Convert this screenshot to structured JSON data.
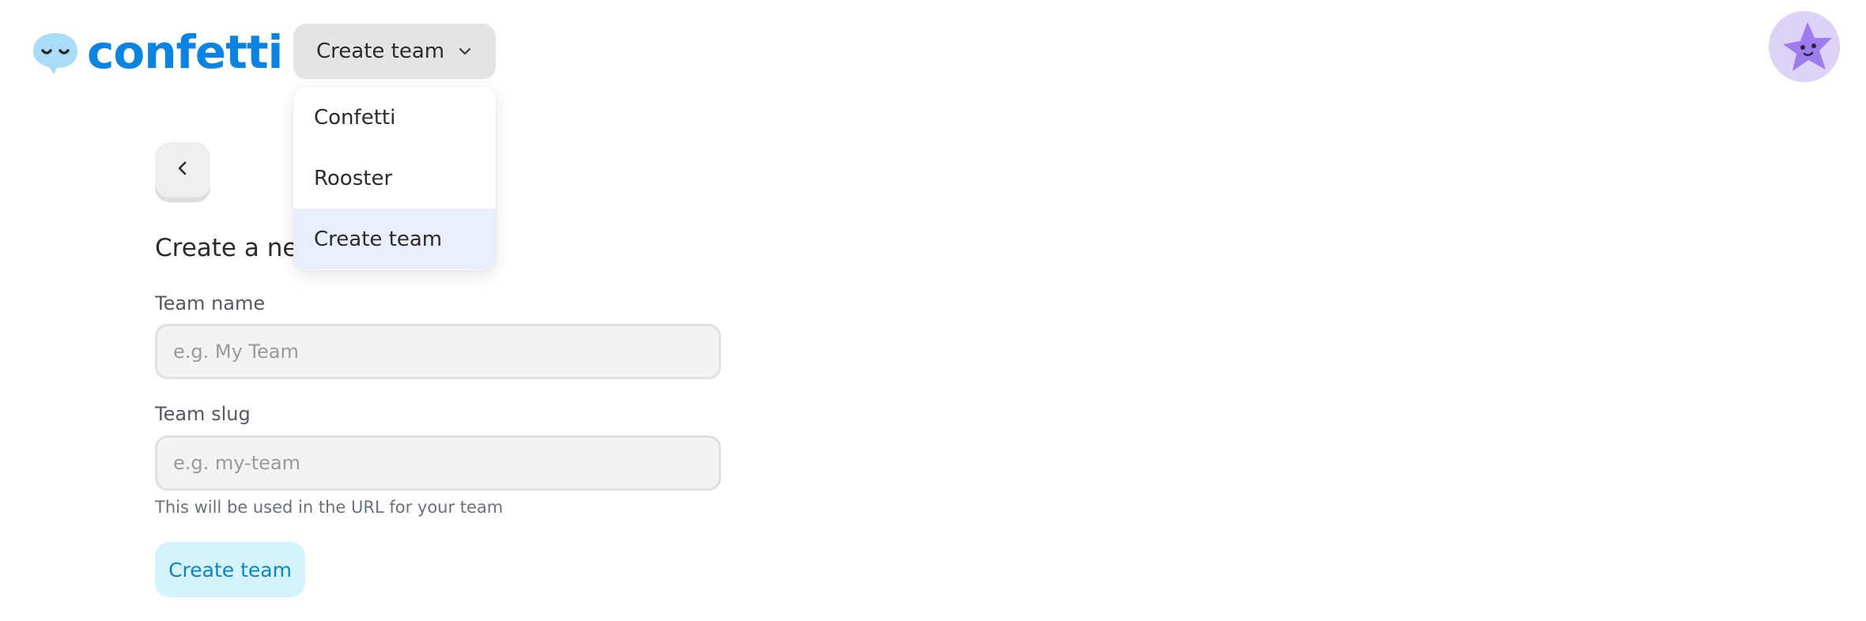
{
  "header": {
    "logo_text": "confetti",
    "team_select": {
      "selected": "Create team",
      "icon": "chevron-down-icon"
    },
    "avatar_icon": "star-avatar-icon"
  },
  "team_menu": {
    "items": [
      {
        "label": "Confetti"
      },
      {
        "label": "Rooster"
      },
      {
        "label": "Create team"
      }
    ],
    "active_index": 2
  },
  "main": {
    "back_icon": "chevron-left-icon",
    "heading": "Create a new team",
    "team_name": {
      "label": "Team name",
      "value": "",
      "placeholder": "e.g. My Team"
    },
    "team_slug": {
      "label": "Team slug",
      "value": "",
      "placeholder": "e.g. my-team",
      "hint": "This will be used in the URL for your team"
    },
    "submit_label": "Create team"
  },
  "colors": {
    "brand": "#0a84e0",
    "menu_active_bg": "#e8eefc",
    "button_bg": "#d4f3fc",
    "button_text": "#0b84c6",
    "avatar_bg": "#dcd3f6",
    "star": "#9d7cf0"
  }
}
